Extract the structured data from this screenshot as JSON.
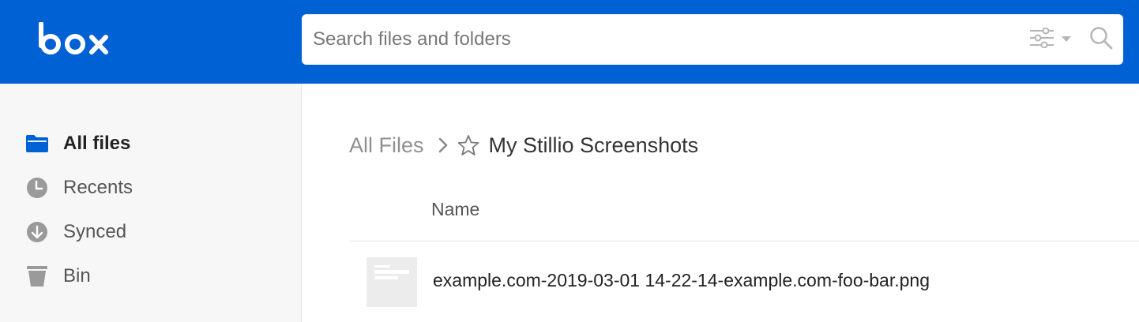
{
  "app": {
    "logo_text": "box"
  },
  "search": {
    "placeholder": "Search files and folders",
    "value": ""
  },
  "sidebar": {
    "items": [
      {
        "label": "All files",
        "icon": "folder-icon",
        "active": true
      },
      {
        "label": "Recents",
        "icon": "clock-icon",
        "active": false
      },
      {
        "label": "Synced",
        "icon": "download-circle-icon",
        "active": false
      },
      {
        "label": "Bin",
        "icon": "trash-icon",
        "active": false
      }
    ]
  },
  "breadcrumb": {
    "root": "All Files",
    "current": "My Stillio Screenshots"
  },
  "table": {
    "columns": [
      "Name"
    ],
    "rows": [
      {
        "name": "example.com-2019-03-01 14-22-14-example.com-foo-bar.png"
      }
    ]
  },
  "colors": {
    "header": "#0061d5",
    "sidebar_bg": "#f7f7f7",
    "accent": "#0061d5",
    "nav_icon": "#9a9a9a"
  }
}
